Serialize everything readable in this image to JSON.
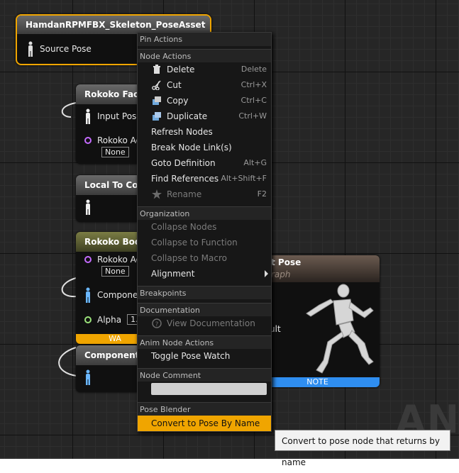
{
  "nodes": {
    "pose_asset": {
      "title": "HamdanRPMFBX_Skeleton_PoseAsset",
      "source_pose": "Source Pose"
    },
    "rokoko_face": {
      "title": "Rokoko Face",
      "input_pose": "Input Pose",
      "actor_label": "Rokoko Ac",
      "actor_value": "None"
    },
    "local_to_component": {
      "title": "Local To Com"
    },
    "rokoko_body": {
      "title": "Rokoko Body",
      "actor_label": "Rokoko Ac",
      "actor_value": "None",
      "component_label": "Componer",
      "alpha_label": "Alpha",
      "alpha_value": "1.0",
      "footer": "WA"
    },
    "component_to": {
      "title": "Component T"
    },
    "output_pose": {
      "title": "t Pose",
      "subtitle": "raph",
      "result_label": "ult",
      "footer": "NOTE"
    }
  },
  "watermark": "ANI",
  "menu": {
    "sections": {
      "pin_actions": "Pin Actions",
      "node_actions": "Node Actions",
      "organization": "Organization",
      "breakpoints": "Breakpoints",
      "documentation": "Documentation",
      "anim_node_actions": "Anim Node Actions",
      "node_comment": "Node Comment",
      "pose_blender": "Pose Blender"
    },
    "items": {
      "delete": {
        "label": "Delete",
        "shortcut": "Delete",
        "icon": "delete-icon"
      },
      "cut": {
        "label": "Cut",
        "shortcut": "Ctrl+X",
        "icon": "scissors-icon"
      },
      "copy": {
        "label": "Copy",
        "shortcut": "Ctrl+C",
        "icon": "copy-icon"
      },
      "duplicate": {
        "label": "Duplicate",
        "shortcut": "Ctrl+W",
        "icon": "duplicate-icon"
      },
      "refresh_nodes": {
        "label": "Refresh Nodes"
      },
      "break_links": {
        "label": "Break Node Link(s)"
      },
      "goto_definition": {
        "label": "Goto Definition",
        "shortcut": "Alt+G"
      },
      "find_references": {
        "label": "Find References",
        "shortcut": "Alt+Shift+F"
      },
      "rename": {
        "label": "Rename",
        "shortcut": "F2",
        "icon": "rename-star-icon"
      },
      "collapse_nodes": {
        "label": "Collapse Nodes"
      },
      "collapse_function": {
        "label": "Collapse to Function"
      },
      "collapse_macro": {
        "label": "Collapse to Macro"
      },
      "alignment": {
        "label": "Alignment"
      },
      "view_documentation": {
        "label": "View Documentation",
        "icon": "help-icon"
      },
      "toggle_pose_watch": {
        "label": "Toggle Pose Watch"
      },
      "convert_pose_by_name": {
        "label": "Convert to Pose By Name"
      }
    }
  },
  "tooltip": "Convert to pose node that returns by name"
}
